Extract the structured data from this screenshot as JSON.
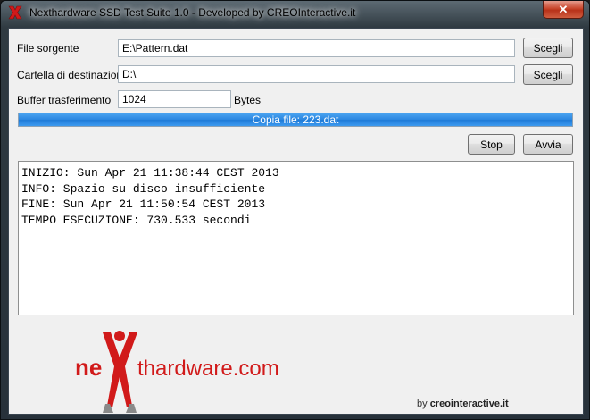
{
  "window": {
    "title": "Nexthardware SSD Test Suite 1.0 - Developed by CREOInteractive.it",
    "close_label": "✕"
  },
  "form": {
    "source_label": "File sorgente",
    "source_value": "E:\\Pattern.dat",
    "dest_label": "Cartella di destinazione",
    "dest_value": "D:\\",
    "buffer_label": "Buffer trasferimento",
    "buffer_value": "1024",
    "buffer_unit": "Bytes",
    "browse_label": "Scegli"
  },
  "progress": {
    "text": "Copia file: 223.dat",
    "fraction": 1.0,
    "color": "#2a86e0"
  },
  "buttons": {
    "stop": "Stop",
    "start": "Avvia"
  },
  "log": {
    "lines": [
      "INIZIO: Sun Apr 21 11:38:44 CEST 2013",
      "INFO: Spazio su disco insufficiente",
      "FINE: Sun Apr 21 11:50:54 CEST 2013",
      "TEMPO ESECUZIONE: 730.533 secondi"
    ]
  },
  "branding": {
    "logo_prefix": "ne",
    "logo_suffix": "thardware.com",
    "credit_prefix": "by ",
    "credit_name": "creointeractive.it",
    "logo_red": "#d11a1a",
    "logo_gray": "#8a8a8a"
  }
}
